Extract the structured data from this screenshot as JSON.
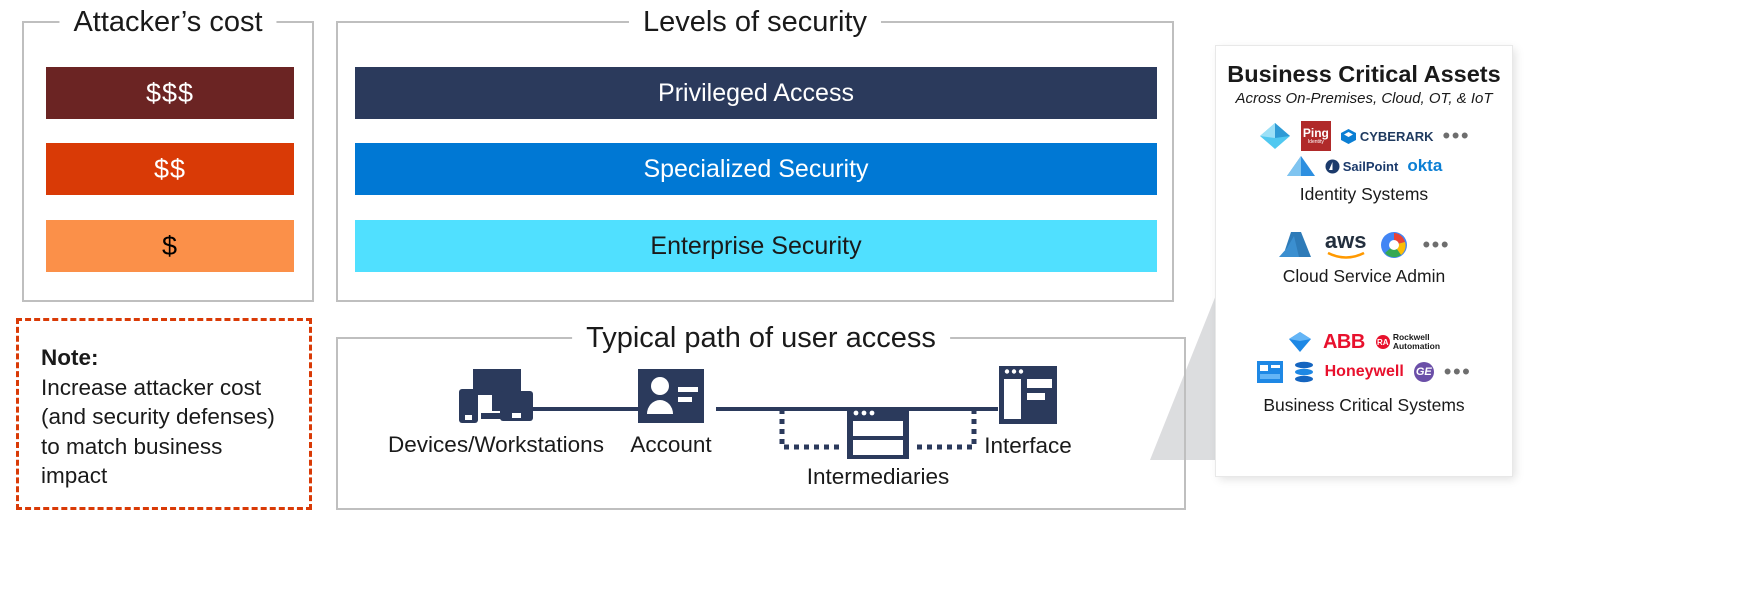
{
  "attacker": {
    "title": "Attacker’s cost",
    "bars": [
      {
        "label": "$$$",
        "color": "#6B2423"
      },
      {
        "label": "$$",
        "color": "#D93A06"
      },
      {
        "label": "$",
        "color": "#FB9049"
      }
    ]
  },
  "note": {
    "label": "Note:",
    "text": "Increase attacker cost (and security defenses) to match business impact",
    "border_color": "#D93A06"
  },
  "levels": {
    "title": "Levels of security",
    "bars": [
      {
        "label": "Privileged Access",
        "color": "#2B3A5C",
        "text_color": "#ffffff"
      },
      {
        "label": "Specialized Security",
        "color": "#0078D4",
        "text_color": "#ffffff"
      },
      {
        "label": "Enterprise Security",
        "color": "#50E0FF",
        "text_color": "#1a1a1a"
      }
    ]
  },
  "path": {
    "title": "Typical path of user access",
    "nodes": [
      {
        "label": "Devices/Workstations",
        "icon": "devices-workstations-icon"
      },
      {
        "label": "Account",
        "icon": "account-card-icon"
      },
      {
        "label": "Intermediaries",
        "icon": "intermediaries-icon"
      },
      {
        "label": "Interface",
        "icon": "interface-window-icon"
      }
    ],
    "line_color": "#2B3A5C"
  },
  "assets": {
    "title": "Business Critical Assets",
    "subtitle": "Across On-Premises, Cloud, OT, & IoT",
    "groups": [
      {
        "caption": "Identity Systems",
        "rows": [
          {
            "logos": [
              "azure-ad-icon",
              "ping-identity-logo",
              "cyberark-logo"
            ],
            "more": "•••"
          },
          {
            "logos": [
              "keeper-pyramid-icon",
              "sailpoint-logo",
              "okta-logo"
            ],
            "more": ""
          }
        ]
      },
      {
        "caption": "Cloud Service Admin",
        "rows": [
          {
            "logos": [
              "azure-logo",
              "aws-logo",
              "google-cloud-logo"
            ],
            "more": "•••"
          }
        ]
      },
      {
        "caption": "Business Critical Systems",
        "rows": [
          {
            "logos": [
              "sap-diamond-icon",
              "abb-logo",
              "rockwell-automation-logo"
            ],
            "more": ""
          },
          {
            "logos": [
              "dashboard-icon",
              "database-icon",
              "honeywell-logo",
              "ge-logo"
            ],
            "more": "•••"
          }
        ]
      }
    ],
    "logo_labels": {
      "ping": "Ping",
      "ping_sub": "Identity",
      "cyberark": "CYBERARK",
      "sailpoint": "SailPoint",
      "okta": "okta",
      "aws": "aws",
      "abb": "ABB",
      "rockwell_1": "Rockwell",
      "rockwell_2": "Automation",
      "rockwell_mark": "RA",
      "honeywell": "Honeywell",
      "ge": "GE"
    }
  },
  "colors": {
    "panel_border": "#bfbfbf",
    "funnel": "#dcdddf",
    "navy": "#2B3A5C",
    "blue": "#0078D4",
    "cyan": "#50E0FF",
    "accent_orange": "#D93A06",
    "red": "#E8112D"
  }
}
